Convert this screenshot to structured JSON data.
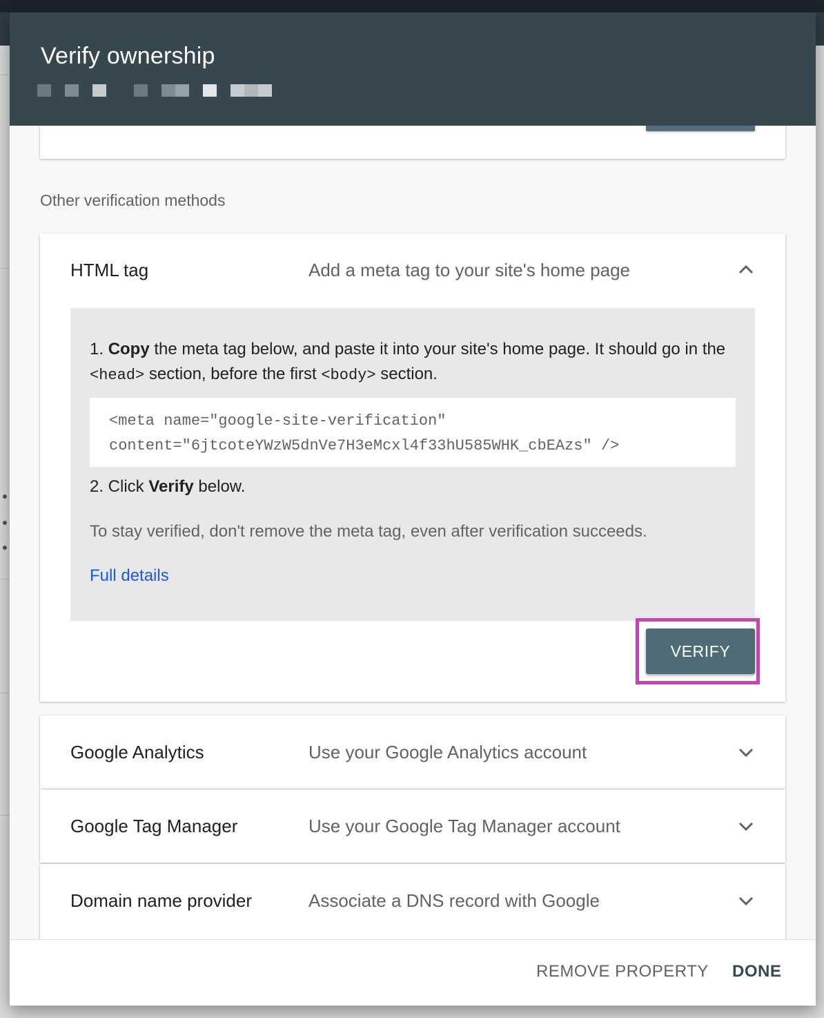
{
  "dialog": {
    "title": "Verify ownership"
  },
  "section_label": "Other verification methods",
  "html_tag": {
    "name": "HTML tag",
    "description": "Add a meta tag to your site's home page",
    "step1_prefix": "1. ",
    "step1_bold": "Copy",
    "step1_text": " the meta tag below, and paste it into your site's home page. It should go in the ",
    "step1_head": "<head>",
    "step1_mid": " section, before the first ",
    "step1_body": "<body>",
    "step1_end": " section.",
    "code_line1": "<meta name=\"google-site-verification\"",
    "code_line2": "content=\"6jtcoteYWzW5dnVe7H3eMcxl4f33hU585WHK_cbEAzs\" />",
    "step2_prefix": "2. Click ",
    "step2_bold": "Verify",
    "step2_suffix": " below.",
    "note": "To stay verified, don't remove the meta tag, even after verification succeeds.",
    "details_link": "Full details",
    "verify_label": "VERIFY"
  },
  "methods": [
    {
      "name": "Google Analytics",
      "description": "Use your Google Analytics account"
    },
    {
      "name": "Google Tag Manager",
      "description": "Use your Google Tag Manager account"
    },
    {
      "name": "Domain name provider",
      "description": "Associate a DNS record with Google"
    }
  ],
  "footer": {
    "remove_label": "REMOVE PROPERTY",
    "done_label": "DONE"
  },
  "colors": {
    "header": "#37474f",
    "verify_button": "#4f6b78",
    "highlight": "#c743b5",
    "link": "#1a56e8"
  }
}
